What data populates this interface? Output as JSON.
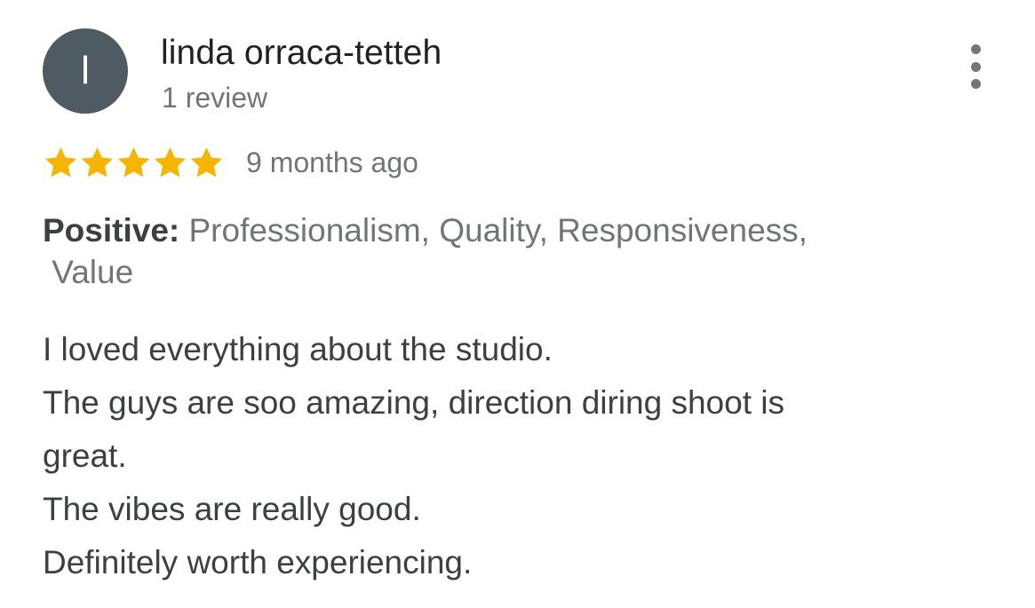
{
  "reviewer": {
    "avatar_initial": "l",
    "avatar_color": "#4f5b62",
    "name": "linda orraca-tetteh",
    "review_count": "1 review"
  },
  "menu": {
    "icon": "more-vert-icon"
  },
  "rating": {
    "stars": 5,
    "max_stars": 5,
    "star_color": "#f4b400",
    "star_icon": "star-icon",
    "timestamp": "9 months ago"
  },
  "highlights": {
    "label": "Positive:",
    "line1": " Professionalism, Quality, Responsiveness,",
    "line2": " Value"
  },
  "review": {
    "lines": [
      "I loved everything about the studio.",
      "The guys are soo amazing, direction diring shoot is",
      "great.",
      "The vibes are really good.",
      "Definitely worth experiencing."
    ]
  }
}
